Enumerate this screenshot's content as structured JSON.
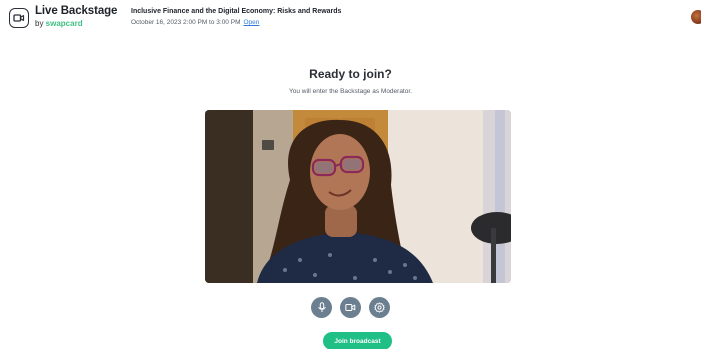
{
  "brand": {
    "title": "Live Backstage",
    "by": "by ",
    "company": "swapcard",
    "icon": "video-camera-icon"
  },
  "event": {
    "title": "Inclusive Finance and the Digital Economy: Risks and Rewards",
    "schedule": "October 16, 2023 2:00 PM to 3:00 PM",
    "status_link": "Open"
  },
  "user": {
    "avatar": "user-avatar"
  },
  "main": {
    "heading": "Ready to join?",
    "subheading": "You will enter the Backstage as Moderator."
  },
  "controls": [
    {
      "name": "microphone-button",
      "icon": "microphone-icon"
    },
    {
      "name": "camera-button",
      "icon": "video-camera-icon"
    },
    {
      "name": "settings-button",
      "icon": "gear-icon"
    }
  ],
  "join_button": {
    "label": "Join broadcast"
  },
  "colors": {
    "accent": "#1fbf86",
    "control_bg": "#6b7f90",
    "link": "#2f7bdc",
    "brand_green": "#3fbf83"
  }
}
